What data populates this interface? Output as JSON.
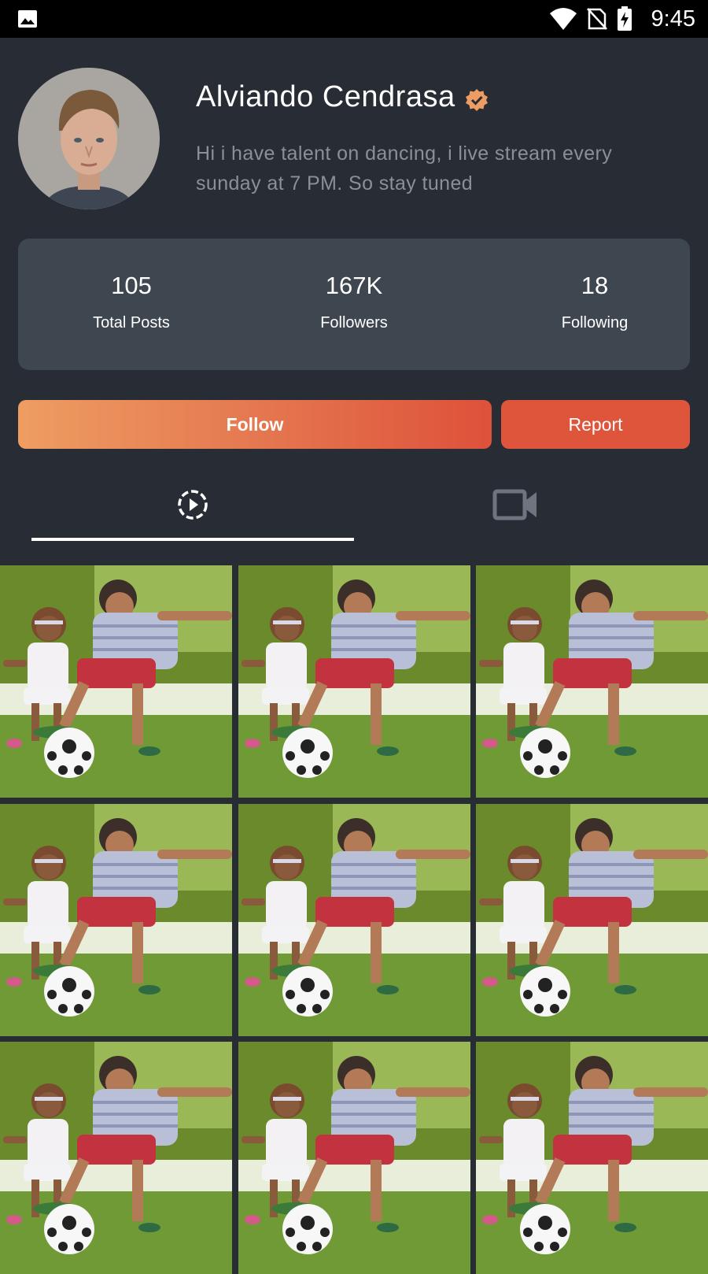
{
  "status_bar": {
    "time": "9:45"
  },
  "profile": {
    "name": "Alviando Cendrasa",
    "bio": "Hi i have talent on dancing, i live stream every sunday at 7 PM. So stay tuned",
    "verified": true
  },
  "stats": [
    {
      "value": "105",
      "label": "Total Posts"
    },
    {
      "value": "167K",
      "label": "Followers"
    },
    {
      "value": "18",
      "label": "Following"
    }
  ],
  "actions": {
    "follow_label": "Follow",
    "report_label": "Report"
  },
  "tabs": [
    {
      "icon": "play-circle-icon",
      "selected": true
    },
    {
      "icon": "video-camera-icon",
      "selected": false
    }
  ],
  "colors": {
    "background": "#282d35",
    "card": "#3e4650",
    "accent_start": "#ee9d62",
    "accent_end": "#de513a",
    "verified_badge": "#ee9d62"
  }
}
